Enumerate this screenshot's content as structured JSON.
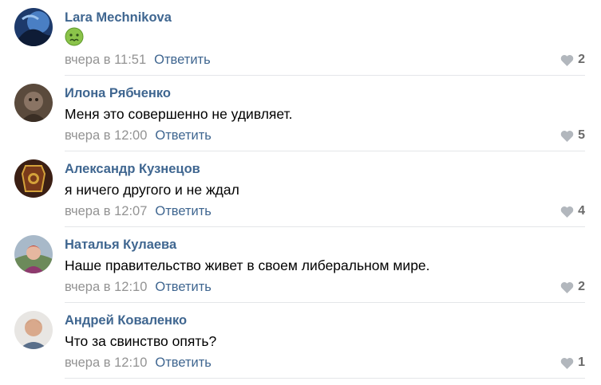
{
  "comments": [
    {
      "author": "Lara Mechnikova",
      "text": "",
      "emoji": "nauseated-face-emoji",
      "date": "вчера в 11:51",
      "reply": "Ответить",
      "likes": "2"
    },
    {
      "author": "Илона Рябченко",
      "text": "Меня это совершенно не удивляет.",
      "date": "вчера в 12:00",
      "reply": "Ответить",
      "likes": "5"
    },
    {
      "author": "Александр Кузнецов",
      "text": "я ничего другого и не ждал",
      "date": "вчера в 12:07",
      "reply": "Ответить",
      "likes": "4"
    },
    {
      "author": "Наталья Кулаева",
      "text": "Наше правительство живет в своем либеральном мире.",
      "date": "вчера в 12:10",
      "reply": "Ответить",
      "likes": "2"
    },
    {
      "author": "Андрей Коваленко",
      "text": "Что за свинство опять?",
      "date": "вчера в 12:10",
      "reply": "Ответить",
      "likes": "1"
    }
  ],
  "colors": {
    "author": "#3f6690",
    "meta": "#939393",
    "heart": "#b2b7bd",
    "divider": "#e4e6e9"
  },
  "icons": {
    "like": "heart-icon"
  }
}
